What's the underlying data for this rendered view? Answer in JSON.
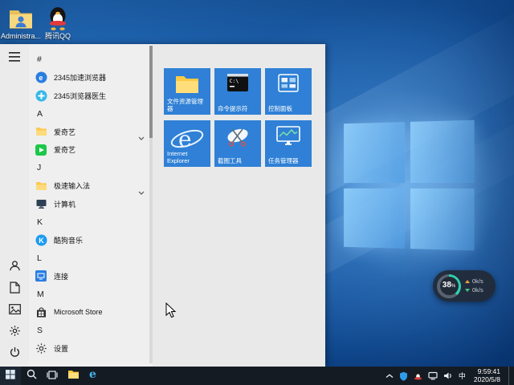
{
  "desktop": {
    "icons": [
      {
        "label": "Administra...",
        "icon": "user-folder-icon"
      },
      {
        "label": "腾讯QQ",
        "icon": "qq-icon"
      }
    ]
  },
  "start_menu": {
    "app_list": [
      {
        "kind": "header",
        "label": "#"
      },
      {
        "kind": "app",
        "label": "2345加速浏览器",
        "icon": "2345-browser-icon"
      },
      {
        "kind": "app",
        "label": "2345浏览器医生",
        "icon": "2345-doctor-icon"
      },
      {
        "kind": "header",
        "label": "A"
      },
      {
        "kind": "folder",
        "label": "爱奇艺",
        "icon": "folder-icon",
        "expander": "chevron-down-icon"
      },
      {
        "kind": "app",
        "label": "爱奇艺",
        "icon": "iqiyi-icon"
      },
      {
        "kind": "header",
        "label": "J"
      },
      {
        "kind": "folder",
        "label": "极速输入法",
        "icon": "folder-icon",
        "expander": "chevron-down-icon"
      },
      {
        "kind": "app",
        "label": "计算机",
        "icon": "computer-icon"
      },
      {
        "kind": "header",
        "label": "K"
      },
      {
        "kind": "app",
        "label": "酷狗音乐",
        "icon": "kugou-icon"
      },
      {
        "kind": "header",
        "label": "L"
      },
      {
        "kind": "app",
        "label": "连接",
        "icon": "connect-icon"
      },
      {
        "kind": "header",
        "label": "M"
      },
      {
        "kind": "app",
        "label": "Microsoft Store",
        "icon": "store-icon"
      },
      {
        "kind": "header",
        "label": "S"
      },
      {
        "kind": "app",
        "label": "设置",
        "icon": "settings-gear-icon"
      }
    ],
    "rail_icons": [
      "hamburger-icon",
      "user-icon",
      "documents-icon",
      "pictures-icon",
      "settings-gear-icon",
      "power-icon"
    ],
    "tiles": [
      {
        "label": "文件资源管理器",
        "icon": "file-explorer-icon"
      },
      {
        "label": "命令提示符",
        "icon": "command-prompt-icon"
      },
      {
        "label": "控制面板",
        "icon": "control-panel-icon"
      },
      {
        "label": "Internet Explorer",
        "icon": "internet-explorer-icon"
      },
      {
        "label": "截图工具",
        "icon": "snipping-tool-icon"
      },
      {
        "label": "任务管理器",
        "icon": "task-manager-icon"
      }
    ]
  },
  "taskbar": {
    "icons": [
      "start-windows-icon",
      "search-icon",
      "task-view-icon",
      "file-explorer-icon",
      "edge-icon"
    ]
  },
  "tray": {
    "icons": [
      "hidden-icons-chevron-icon",
      "security-shield-icon",
      "qq-tray-icon",
      "network-icon",
      "volume-icon"
    ],
    "ime_indicator": "中",
    "time": "9:59:41",
    "date": "2020/5/8"
  },
  "net_widget": {
    "percent": "38",
    "percent_unit": "%",
    "up_speed": "0k/s",
    "down_speed": "0k/s"
  },
  "colors": {
    "tile_blue": "#2f80d6",
    "taskbar_bg": "#151b23",
    "gauge_ring_teal": "#2fd0ae",
    "wallpaper_blue": "#1b5fac",
    "start_menu_bg": "#efefef"
  }
}
